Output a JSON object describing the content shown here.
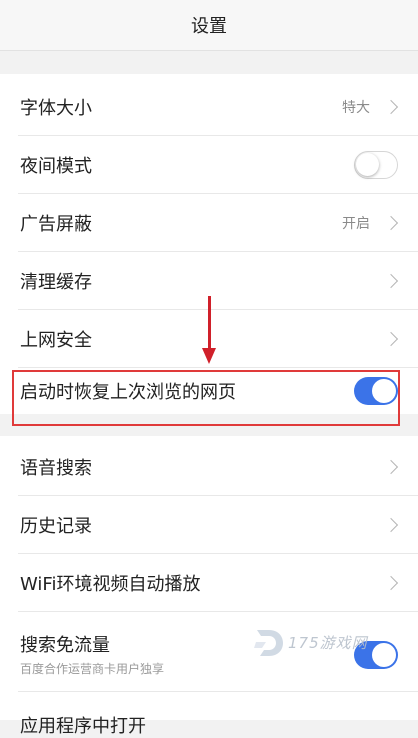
{
  "header": {
    "title": "设置"
  },
  "settings_group1": [
    {
      "label": "字体大小",
      "value": "特大"
    },
    {
      "label": "夜间模式",
      "toggle": "off"
    },
    {
      "label": "广告屏蔽",
      "value": "开启"
    },
    {
      "label": "清理缓存"
    },
    {
      "label": "上网安全"
    },
    {
      "label": "启动时恢复上次浏览的网页",
      "toggle": "on"
    }
  ],
  "settings_group2": [
    {
      "label": "语音搜索"
    },
    {
      "label": "历史记录"
    },
    {
      "label": "WiFi环境视频自动播放"
    },
    {
      "label": "搜索免流量",
      "subtitle": "百度合作运营商卡用户独享",
      "toggle": "on"
    }
  ],
  "partial_next_row": "应用程序中打开",
  "watermark": {
    "text": "175游戏网"
  },
  "colors": {
    "accent": "#3b73e8",
    "highlight": "#e03a3a",
    "arrow": "#d0202a"
  },
  "icons": [
    "chevron-right-icon",
    "toggle-switch",
    "watermark-logo-icon",
    "down-arrow-annotation"
  ]
}
